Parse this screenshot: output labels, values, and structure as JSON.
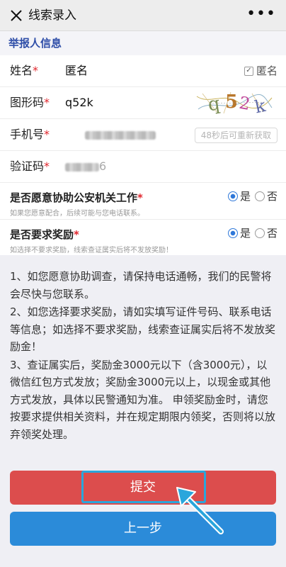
{
  "header": {
    "title": "线索录入",
    "more": "•••"
  },
  "section": {
    "title": "举报人信息"
  },
  "form": {
    "name": {
      "label": "姓名",
      "required": "*",
      "value": "匿名",
      "anon_label": "匿名",
      "anon_check": "✓"
    },
    "captcha": {
      "label": "图形码",
      "required": "*",
      "value": "q52k",
      "image_text": "q52k"
    },
    "phone": {
      "label": "手机号",
      "required": "*",
      "button": "48秒后可重新获取"
    },
    "code": {
      "label": "验证码",
      "required": "*",
      "value_tail": "6"
    }
  },
  "questions": {
    "assist": {
      "text": "是否愿意协助公安机关工作",
      "required": "*",
      "yes": "是",
      "no": "否",
      "hint": "如果您愿意配合，后续可能与您电话联系。"
    },
    "reward": {
      "text": "是否要求奖励",
      "required": "*",
      "yes": "是",
      "no": "否",
      "hint": "如选择不要求奖励，线索查证属实后将不发放奖励！"
    }
  },
  "notice": {
    "p1": "1、如您愿意协助调查，请保持电话通畅，我们的民警将会尽快与您联系。",
    "p2": "2、如您选择要求奖励，请如实填写证件号码、联系电话等信息；如选择不要求奖励，线索查证属实后将不发放奖励金！",
    "p3": "3、查证属实后，奖励金3000元以下（含3000元），以微信红包方式发放；奖励金3000元以上，以现金或其他方式发放，具体以民警通知为准。 申领奖励金时，请您按要求提供相关资料，并在规定期限内领奖，否则将以放弃领奖处理。"
  },
  "buttons": {
    "submit": "提交",
    "back": "上一步"
  },
  "colors": {
    "submit": "#dc4d4d",
    "back": "#2b8bd9",
    "highlight": "#2aa6dc",
    "accent": "#2f4ea8"
  }
}
